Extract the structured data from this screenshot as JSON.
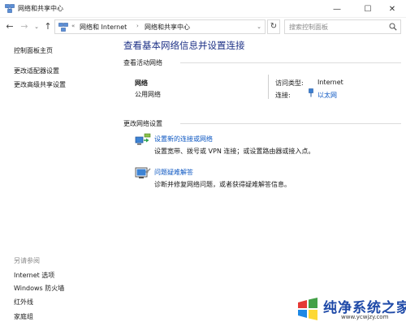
{
  "window": {
    "title": "网络和共享中心",
    "minimize": "—",
    "maximize": "☐",
    "close": "✕"
  },
  "nav": {
    "back": "←",
    "forward": "→",
    "recent": "⌄",
    "up": "↑"
  },
  "address": {
    "root_sep": "«",
    "crumb1": "网络和 Internet",
    "sep": "›",
    "crumb2": "网络和共享中心",
    "dropdown": "⌄",
    "refresh": "↻"
  },
  "search": {
    "placeholder": "搜索控制面板"
  },
  "sidebar": {
    "items": [
      {
        "label": "控制面板主页"
      },
      {
        "label": "更改适配器设置"
      },
      {
        "label": "更改高级共享设置"
      }
    ],
    "see_also_heading": "另请参阅",
    "see_also": [
      {
        "label": "Internet 选项"
      },
      {
        "label": "Windows 防火墙"
      },
      {
        "label": "红外线"
      },
      {
        "label": "家庭组"
      }
    ]
  },
  "main": {
    "title": "查看基本网络信息并设置连接",
    "active_networks_heading": "查看活动网络",
    "network": {
      "name": "网络",
      "type": "公用网络",
      "access_type_label": "访问类型:",
      "access_type_value": "Internet",
      "connection_label": "连接:",
      "connection_value": "以太网"
    },
    "change_settings_heading": "更改网络设置",
    "tasks": [
      {
        "icon": "network-setup-icon",
        "link": "设置新的连接或网络",
        "desc": "设置宽带、拨号或 VPN 连接；或设置路由器或接入点。"
      },
      {
        "icon": "troubleshoot-icon",
        "link": "问题疑难解答",
        "desc": "诊断并修复网络问题，或者获得疑难解答信息。"
      }
    ]
  },
  "watermark": {
    "text": "纯净系统之家",
    "url": "www.ycwjzy.com"
  },
  "colors": {
    "title_blue": "#1e3287",
    "link_blue": "#0b56c2",
    "watermark_blue": "#1f4aa8"
  }
}
